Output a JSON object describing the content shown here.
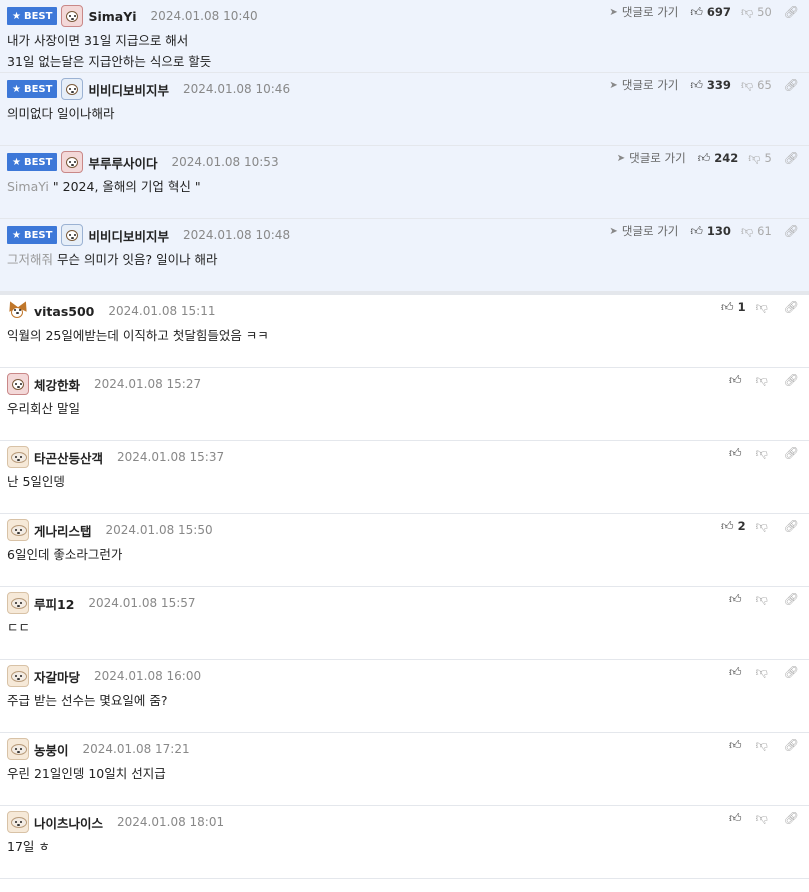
{
  "labels": {
    "best": "BEST",
    "reply": "댓글로 가기"
  },
  "colors": {
    "best_bg": "#eef3fc",
    "badge": "#3d78d8"
  },
  "best_comments": [
    {
      "avatar": "dog-red-icon",
      "name": "SimaYi",
      "date": "2024.01.08 10:40",
      "up": "697",
      "down": "50",
      "quote": "",
      "text": "내가 사장이면 31일 지급으로 해서\n31일 없는달은 지급안하는 식으로 할듯"
    },
    {
      "avatar": "dog-blue-icon",
      "name": "비비디보비지부",
      "date": "2024.01.08 10:46",
      "up": "339",
      "down": "65",
      "quote": "",
      "text": "의미없다 일이나해라"
    },
    {
      "avatar": "dog-red-icon",
      "name": "부루루사이다",
      "date": "2024.01.08 10:53",
      "up": "242",
      "down": "5",
      "quote": "SimaYi",
      "text": "\" 2024, 올해의 기업 혁신 \""
    },
    {
      "avatar": "dog-blue-icon",
      "name": "비비디보비지부",
      "date": "2024.01.08 10:48",
      "up": "130",
      "down": "61",
      "quote": "그저해줘",
      "text": "무슨 의미가 잇음? 일이나 해라"
    }
  ],
  "comments": [
    {
      "avatar": "fox-icon",
      "name": "vitas500",
      "date": "2024.01.08 15:11",
      "up": "1",
      "text": "익월의 25일에받는데 이직하고 첫달힘들었음 ㅋㅋ"
    },
    {
      "avatar": "dog-red-icon",
      "name": "체강한화",
      "date": "2024.01.08 15:27",
      "up": "",
      "text": "우리회산 말일"
    },
    {
      "avatar": "puppy-icon",
      "name": "타곤산등산객",
      "date": "2024.01.08 15:37",
      "up": "",
      "text": "난 5일인뎅"
    },
    {
      "avatar": "puppy-icon",
      "name": "게나리스탭",
      "date": "2024.01.08 15:50",
      "up": "2",
      "text": "6일인데 좋소라그런가"
    },
    {
      "avatar": "puppy-icon",
      "name": "루피12",
      "date": "2024.01.08 15:57",
      "up": "",
      "text": "ㄷㄷ"
    },
    {
      "avatar": "puppy-icon",
      "name": "자갈마당",
      "date": "2024.01.08 16:00",
      "up": "",
      "text": "주급 받는 선수는 몇요일에 줌?"
    },
    {
      "avatar": "puppy-icon",
      "name": "농붕이",
      "date": "2024.01.08 17:21",
      "up": "",
      "text": "우린 21일인뎅 10일치 선지급"
    },
    {
      "avatar": "puppy-icon",
      "name": "나이츠나이스",
      "date": "2024.01.08 18:01",
      "up": "",
      "text": "17일 ㅎ"
    }
  ]
}
